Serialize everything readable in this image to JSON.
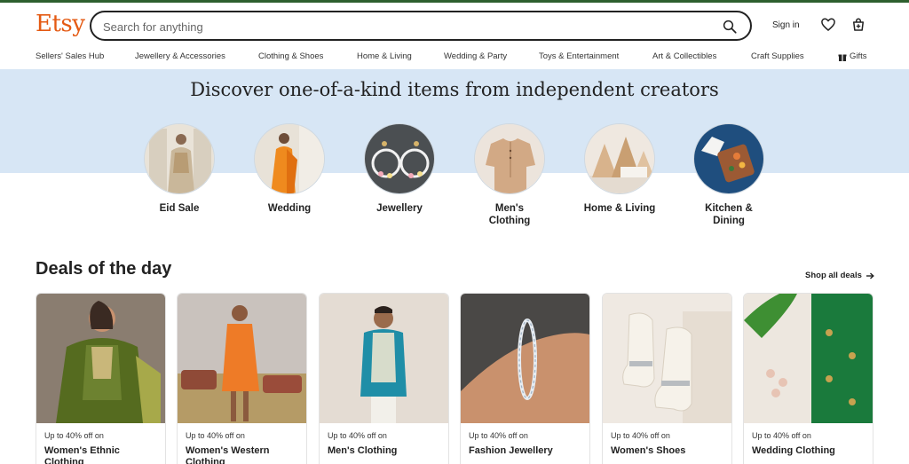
{
  "header": {
    "logo": "Etsy",
    "search_placeholder": "Search for anything",
    "sign_in": "Sign in"
  },
  "nav": [
    "Sellers' Sales Hub",
    "Jewellery & Accessories",
    "Clothing & Shoes",
    "Home & Living",
    "Wedding & Party",
    "Toys & Entertainment",
    "Art & Collectibles",
    "Craft Supplies",
    "Gifts"
  ],
  "hero": {
    "headline": "Discover one-of-a-kind items from independent creators",
    "categories": [
      "Eid Sale",
      "Wedding",
      "Jewellery",
      "Men's Clothing",
      "Home & Living",
      "Kitchen & Dining"
    ]
  },
  "deals": {
    "title": "Deals of the day",
    "shop_all": "Shop all deals",
    "cards": [
      {
        "offer": "Up to 40% off on",
        "name": "Women's Ethnic Clothing"
      },
      {
        "offer": "Up to 40% off on",
        "name": "Women's Western Clothing"
      },
      {
        "offer": "Up to 40% off on",
        "name": "Men's Clothing"
      },
      {
        "offer": "Up to 40% off on",
        "name": "Fashion Jewellery"
      },
      {
        "offer": "Up to 40% off on",
        "name": "Women's Shoes"
      },
      {
        "offer": "Up to 40% off on",
        "name": "Wedding Clothing"
      }
    ]
  },
  "colors": {
    "brand": "#e45a13",
    "band": "#d7e6f5",
    "topbar": "#2d5f2e"
  }
}
